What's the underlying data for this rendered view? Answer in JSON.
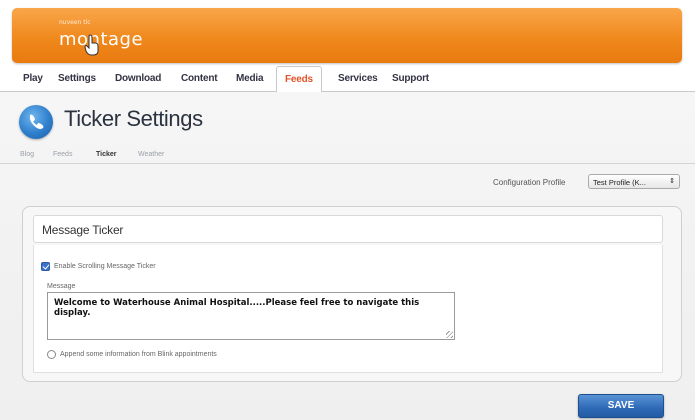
{
  "header": {
    "logo_prefix": "nuveen  tlc",
    "logo_text": "montage",
    "brand_color": "#f0891d"
  },
  "nav": {
    "items": [
      "Play",
      "Settings",
      "Download",
      "Content",
      "Media",
      "Feeds",
      "Services",
      "Support"
    ],
    "active": "Feeds"
  },
  "page": {
    "title": "Ticker Settings",
    "icon": "ticker-settings-icon",
    "subtabs": [
      "Blog",
      "Feeds",
      "Ticker",
      "Weather"
    ],
    "active_subtab": "Ticker"
  },
  "config": {
    "label": "Configuration Profile",
    "selected": "Test Profile (K..."
  },
  "panel": {
    "title": "Message Ticker",
    "enable_label": "Enable Scrolling Message Ticker",
    "enable_checked": true,
    "message_label": "Message",
    "message_value": "Welcome to Waterhouse Animal Hospital.....Please feel free to navigate this display.",
    "append_label": "Append some information from Blink appointments",
    "append_checked": false
  },
  "actions": {
    "save_label": "SAVE"
  }
}
